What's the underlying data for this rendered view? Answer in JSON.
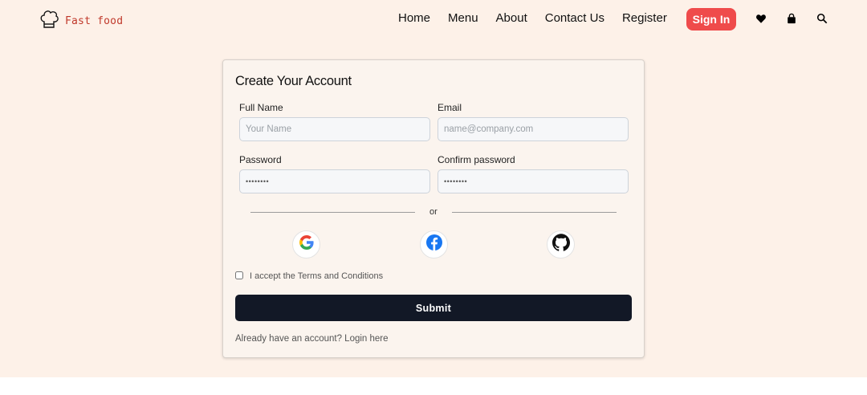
{
  "header": {
    "brand_name": "Fast food",
    "brand_icon": "chef-hat-icon",
    "nav_links": [
      "Home",
      "Menu",
      "About",
      "Contact Us",
      "Register"
    ],
    "sign_in_label": "Sign In",
    "icons": [
      "heart-icon",
      "shopping-bag-icon",
      "search-icon"
    ],
    "accent_color": "#ef4b4b"
  },
  "form": {
    "title": "Create Your Account",
    "full_name": {
      "label": "Full Name",
      "placeholder": "Your Name"
    },
    "email": {
      "label": "Email",
      "placeholder": "name@company.com"
    },
    "password": {
      "label": "Password",
      "value": "••••••••"
    },
    "confirm_password": {
      "label": "Confirm password",
      "value": "••••••••"
    },
    "divider_text": "or",
    "social_logins": [
      "google-icon",
      "facebook-icon",
      "github-icon"
    ],
    "terms_label": "I accept the Terms and Conditions",
    "submit_label": "Submit",
    "login_text": "Already have an account? Login here",
    "submit_color": "#121826"
  },
  "colors": {
    "background": "#fdf1e8",
    "card_background": "#fbf4ee"
  }
}
